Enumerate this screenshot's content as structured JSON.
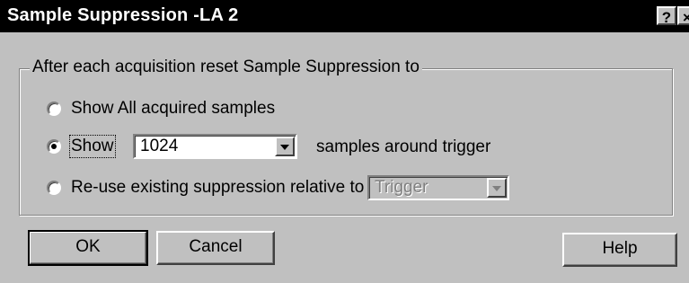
{
  "window": {
    "title": "Sample Suppression -LA 2",
    "help_glyph": "?",
    "close_glyph": "×"
  },
  "group": {
    "legend": "After each acquisition reset Sample Suppression to"
  },
  "options": {
    "show_all_label": "Show All acquired samples",
    "show_label": "Show",
    "show_value": "1024",
    "show_suffix": "samples around trigger",
    "reuse_label": "Re-use existing suppression relative to",
    "reuse_value": "Trigger",
    "selected": "show"
  },
  "buttons": {
    "ok": "OK",
    "cancel": "Cancel",
    "help": "Help"
  },
  "colors": {
    "titlebar": "#000000",
    "face": "#c0c0c0"
  }
}
